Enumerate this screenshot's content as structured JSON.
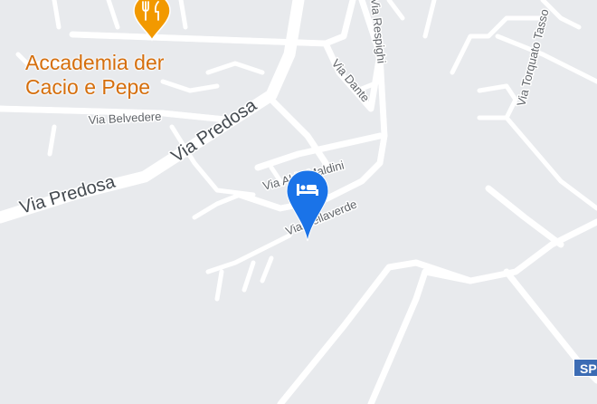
{
  "map": {
    "background": "#e8eaed",
    "road_color": "#ffffff"
  },
  "poi": {
    "name_line1": "Accademia der",
    "name_line2": "Cacio e Pepe",
    "icon": "restaurant-icon",
    "color": "#d56e0c"
  },
  "marker": {
    "icon": "hotel-bed-icon",
    "color": "#1a73e8"
  },
  "streets": {
    "via_predosa_upper": "Via Predosa",
    "via_predosa_lower": "Via Predosa",
    "via_belvedere": "Via Belvedere",
    "via_dante": "Via Dante",
    "via_respighi": "Via Respighi",
    "via_torquato_tasso": "Via Torquato Tasso",
    "via_aldo_maldini": "Via Aldo Maldini",
    "via_bellaverde": "Via Bellaverde"
  },
  "route_shield": {
    "text": "SP",
    "color": "#3c6cb4"
  }
}
